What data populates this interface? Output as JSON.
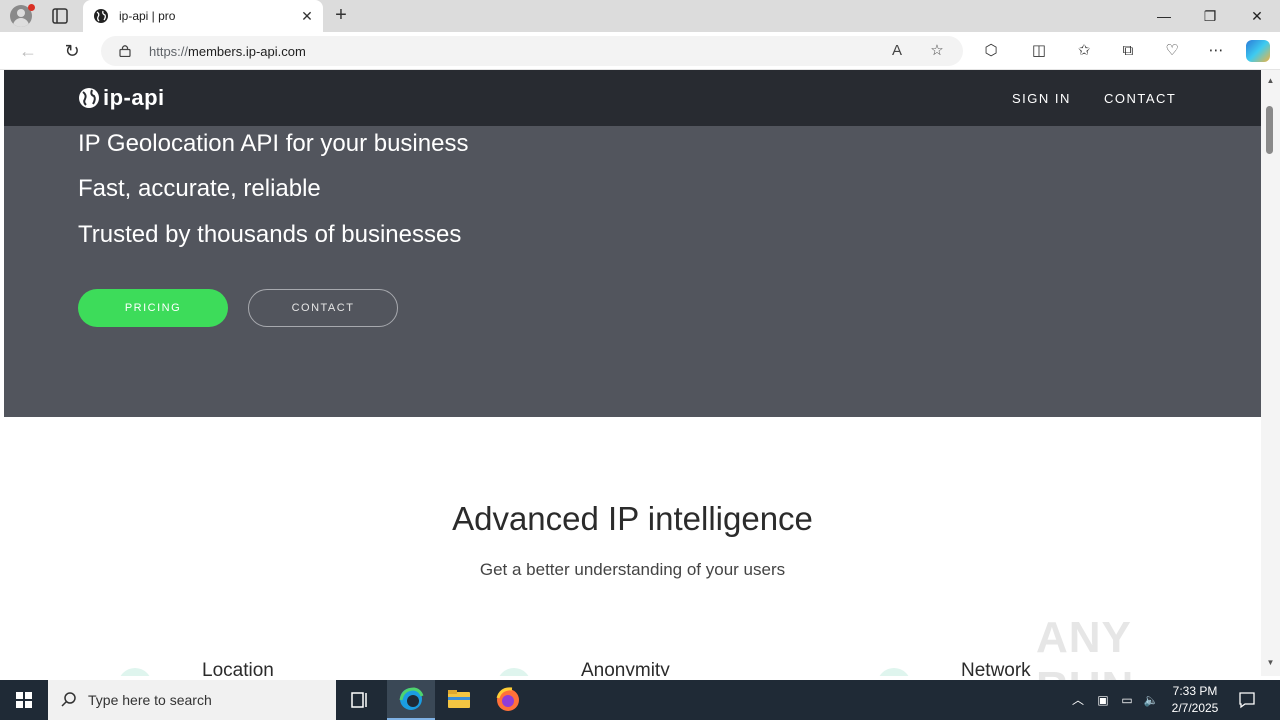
{
  "browser": {
    "tab_title": "ip-api | pro",
    "url_scheme": "https://",
    "url_host": "members.ip-api.com"
  },
  "site": {
    "logo_text": "ip-api",
    "nav": {
      "sign_in": "SIGN IN",
      "contact": "CONTACT"
    },
    "hero": {
      "line1": "IP Geolocation API for your business",
      "line2": "Fast, accurate, reliable",
      "line3": "Trusted by thousands of businesses",
      "pricing_btn": "PRICING",
      "contact_btn": "CONTACT"
    },
    "section": {
      "title": "Advanced IP intelligence",
      "subtitle": "Get a better understanding of your users",
      "features": [
        "Location",
        "Anonymity",
        "Network"
      ]
    }
  },
  "watermark": "ANY RUN",
  "taskbar": {
    "search_placeholder": "Type here to search",
    "time": "7:33 PM",
    "date": "2/7/2025"
  },
  "colors": {
    "hero_bg": "#52555d",
    "navbar_bg": "#282b31",
    "pricing_green": "#3ddc5a",
    "taskbar_bg": "#1f2a36"
  }
}
